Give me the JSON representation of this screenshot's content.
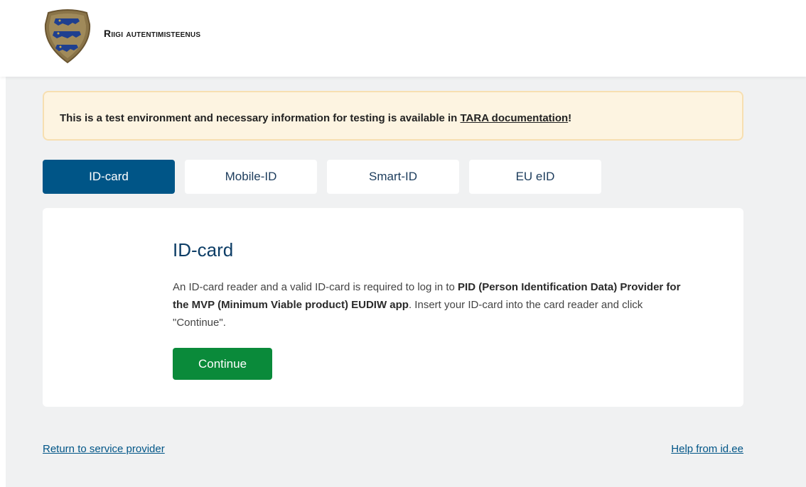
{
  "header": {
    "brand": "Riigi autentimisteenus",
    "logo_icon": "estonian-coat-of-arms-icon"
  },
  "notice": {
    "text_before": "This is a test environment and necessary information for testing is available in ",
    "link_label": "TARA documentation",
    "text_after": "!"
  },
  "tabs": [
    {
      "label": "ID-card",
      "active": true
    },
    {
      "label": "Mobile-ID",
      "active": false
    },
    {
      "label": "Smart-ID",
      "active": false
    },
    {
      "label": "EU eID",
      "active": false
    }
  ],
  "card": {
    "title": "ID-card",
    "text_1": "An ID-card reader and a valid ID-card is required to log in to ",
    "service_name": "PID (Person Identification Data) Provider for the MVP (Minimum Viable product) EUDIW app",
    "text_2": ". Insert your ID-card into the card reader and click \"Continue\".",
    "continue_label": "Continue"
  },
  "footer": {
    "return_label": "Return to service provider",
    "help_label": "Help from id.ee"
  },
  "colors": {
    "primary": "#005587",
    "continue_green": "#0a8a3a",
    "notice_bg": "#fdf4e1",
    "page_bg": "#f0f1f2"
  }
}
